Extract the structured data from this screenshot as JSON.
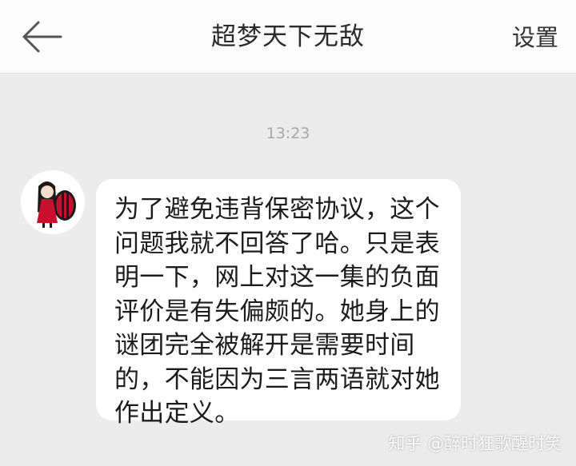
{
  "header": {
    "title": "超梦天下无敌",
    "settings_label": "设置",
    "back_icon": "back-arrow-icon"
  },
  "chat": {
    "timestamp": "13:23",
    "message": {
      "lines": [
        "为了避免违背保密协议，这个",
        "问题我就不回答了哈。只是表",
        "明一下，网上对这一集的负面",
        "评价是有失偏颇的。她身上的",
        "谜团完全被解开是需要时间",
        "的，不能因为三言两语就对她",
        "作出定义。"
      ]
    }
  },
  "watermark": {
    "text": "知乎 @醉时狂歌醒时笑"
  },
  "colors": {
    "background": "#ececec",
    "header_bg": "#fbfbfb",
    "bubble_bg": "#ffffff",
    "avatar_accent": "#c8102e"
  }
}
